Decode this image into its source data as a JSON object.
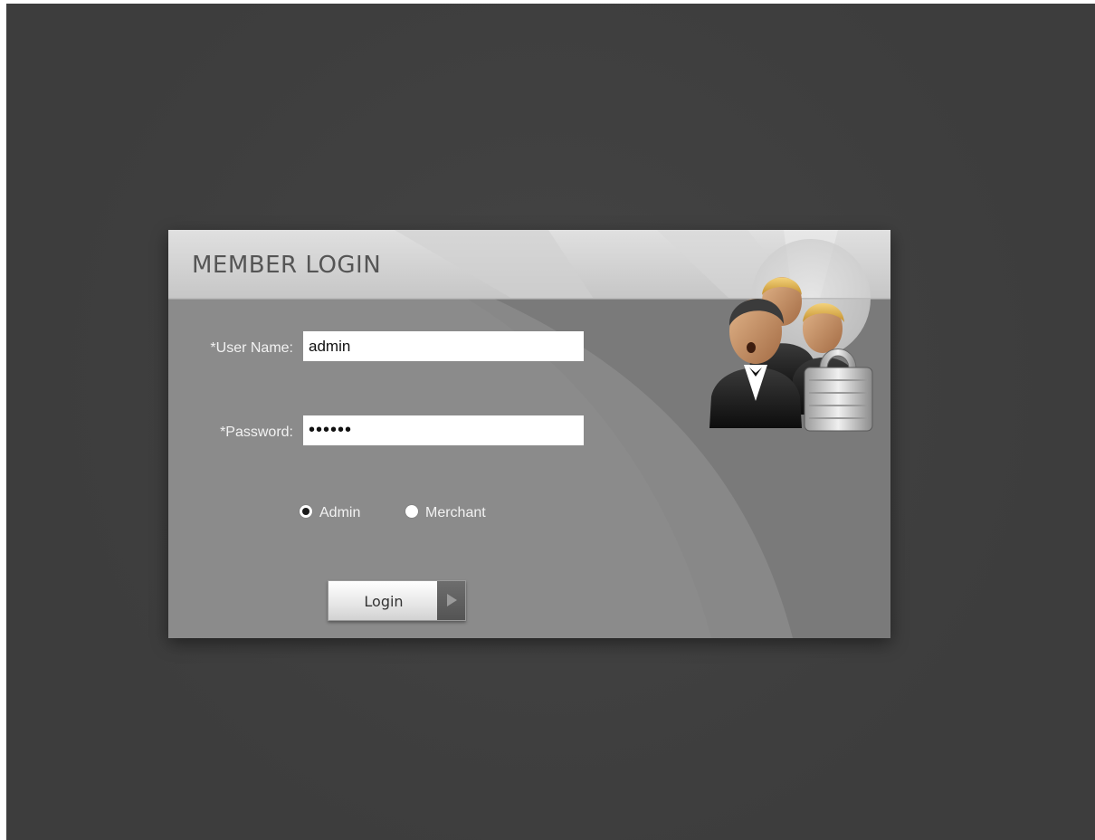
{
  "login": {
    "title": "MEMBER LOGIN",
    "username_label": "*User Name:",
    "username_value": "admin",
    "password_label": "*Password:",
    "password_value": "••••••",
    "roles": [
      {
        "label": "Admin",
        "selected": true
      },
      {
        "label": "Merchant",
        "selected": false
      }
    ],
    "login_button": "Login"
  },
  "icons": {
    "header_icon": "users-lock-icon",
    "button_icon": "play-arrow-icon"
  },
  "colors": {
    "page_background": "#3f3f3f",
    "panel_background": "#7b7b7b",
    "title_text": "#555555"
  }
}
